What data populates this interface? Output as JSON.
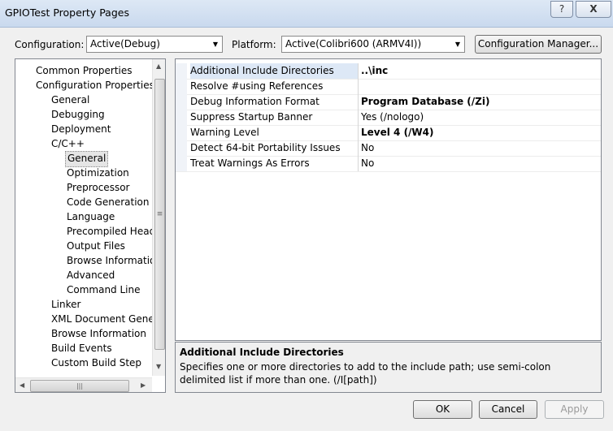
{
  "window": {
    "title": "GPIOTest Property Pages",
    "help_label": "?",
    "close_label": "X"
  },
  "toolbar": {
    "configuration_label": "Configuration:",
    "configuration_value": "Active(Debug)",
    "platform_label": "Platform:",
    "platform_value": "Active(Colibri600 (ARMV4I))",
    "config_manager_label": "Configuration Manager..."
  },
  "tree": {
    "items": [
      {
        "label": "Common Properties"
      },
      {
        "label": "Configuration Properties"
      },
      {
        "label": "General"
      },
      {
        "label": "Debugging"
      },
      {
        "label": "Deployment"
      },
      {
        "label": "C/C++"
      },
      {
        "label": "General"
      },
      {
        "label": "Optimization"
      },
      {
        "label": "Preprocessor"
      },
      {
        "label": "Code Generation"
      },
      {
        "label": "Language"
      },
      {
        "label": "Precompiled Heade"
      },
      {
        "label": "Output Files"
      },
      {
        "label": "Browse Information"
      },
      {
        "label": "Advanced"
      },
      {
        "label": "Command Line"
      },
      {
        "label": "Linker"
      },
      {
        "label": "XML Document Genera"
      },
      {
        "label": "Browse Information"
      },
      {
        "label": "Build Events"
      },
      {
        "label": "Custom Build Step"
      }
    ]
  },
  "properties": [
    {
      "name": "Additional Include Directories",
      "value": "..\\inc"
    },
    {
      "name": "Resolve #using References",
      "value": ""
    },
    {
      "name": "Debug Information Format",
      "value": "Program Database (/Zi)"
    },
    {
      "name": "Suppress Startup Banner",
      "value": "Yes (/nologo)"
    },
    {
      "name": "Warning Level",
      "value": "Level 4 (/W4)"
    },
    {
      "name": "Detect 64-bit Portability Issues",
      "value": "No"
    },
    {
      "name": "Treat Warnings As Errors",
      "value": "No"
    }
  ],
  "description": {
    "title": "Additional Include Directories",
    "text": "Specifies one or more directories to add to the include path; use semi-colon delimited list if more than one.     (/I[path])"
  },
  "buttons": {
    "ok": "OK",
    "cancel": "Cancel",
    "apply": "Apply"
  }
}
